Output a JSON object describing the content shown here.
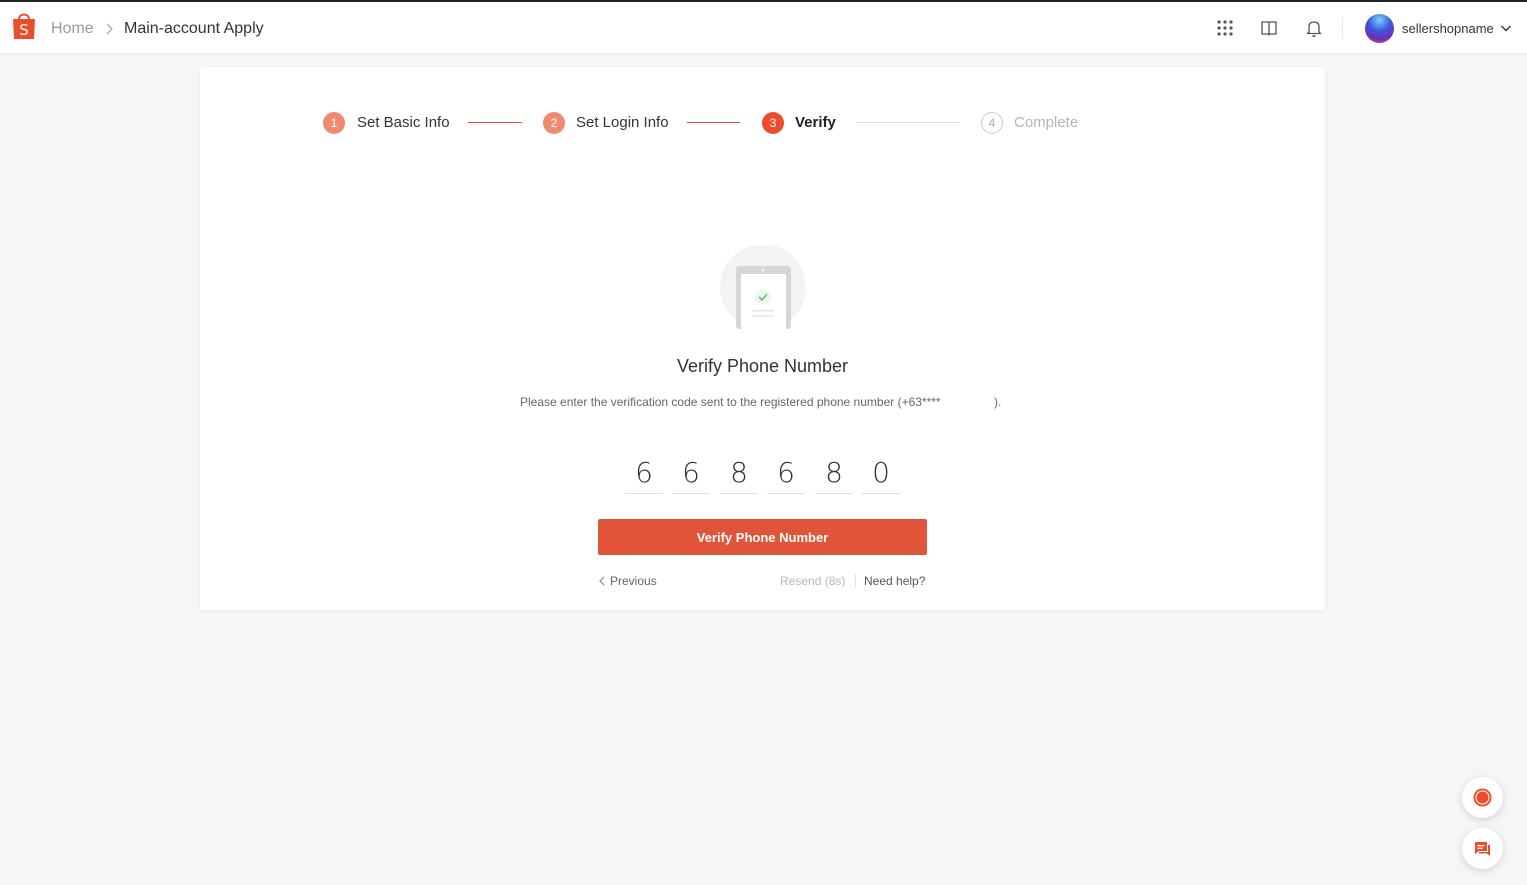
{
  "header": {
    "breadcrumb": {
      "home": "Home",
      "current": "Main-account Apply"
    },
    "icons": [
      "shopee-logo-icon",
      "apps-grid-icon",
      "book-icon",
      "bell-icon",
      "chevron-down-icon"
    ],
    "user": {
      "name": "sellershopname"
    }
  },
  "steps": [
    {
      "number": "1",
      "label": "Set Basic Info",
      "state": "done"
    },
    {
      "number": "2",
      "label": "Set Login Info",
      "state": "done"
    },
    {
      "number": "3",
      "label": "Verify",
      "state": "active"
    },
    {
      "number": "4",
      "label": "Complete",
      "state": "todo"
    }
  ],
  "verify": {
    "title": "Verify Phone Number",
    "description": "Please enter the verification code sent to the registered phone number (+63****",
    "description_end": ").",
    "code_digits": [
      "6",
      "6",
      "8",
      "6",
      "8",
      "0"
    ],
    "button_label": "Verify Phone Number",
    "previous_label": "Previous",
    "resend_label": "Resend (8s)",
    "help_label": "Need help?"
  },
  "colors": {
    "brand": "#ee4d2d",
    "button": "#e0553a",
    "step_done": "#ee8a70"
  }
}
